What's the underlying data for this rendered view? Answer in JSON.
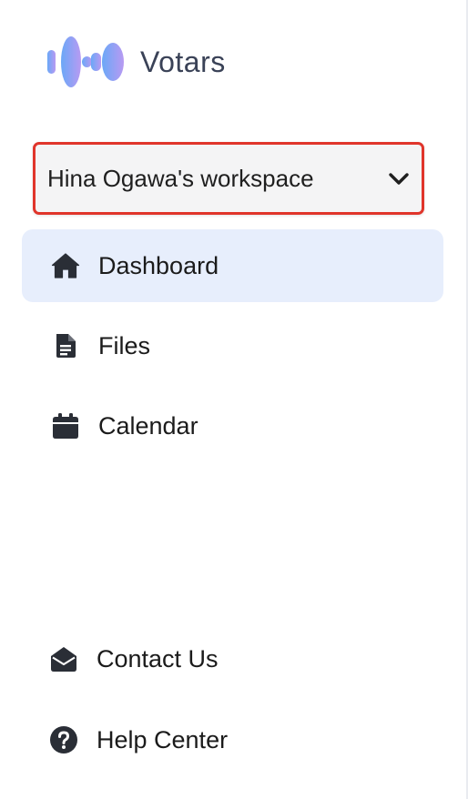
{
  "brand": {
    "name": "Votars"
  },
  "workspace": {
    "selected": "Hina Ogawa's workspace"
  },
  "nav": {
    "items": [
      {
        "label": "Dashboard",
        "icon": "home-icon",
        "active": true
      },
      {
        "label": "Files",
        "icon": "file-icon",
        "active": false
      },
      {
        "label": "Calendar",
        "icon": "calendar-icon",
        "active": false
      }
    ]
  },
  "footer": {
    "items": [
      {
        "label": "Contact Us",
        "icon": "envelope-open-icon"
      },
      {
        "label": "Help Center",
        "icon": "question-circle-icon"
      }
    ]
  },
  "colors": {
    "active_background": "#e7eefc",
    "highlight_border": "#e0352b",
    "logo_gradient_start": "#6aa8f7",
    "logo_gradient_end": "#b89af2"
  }
}
